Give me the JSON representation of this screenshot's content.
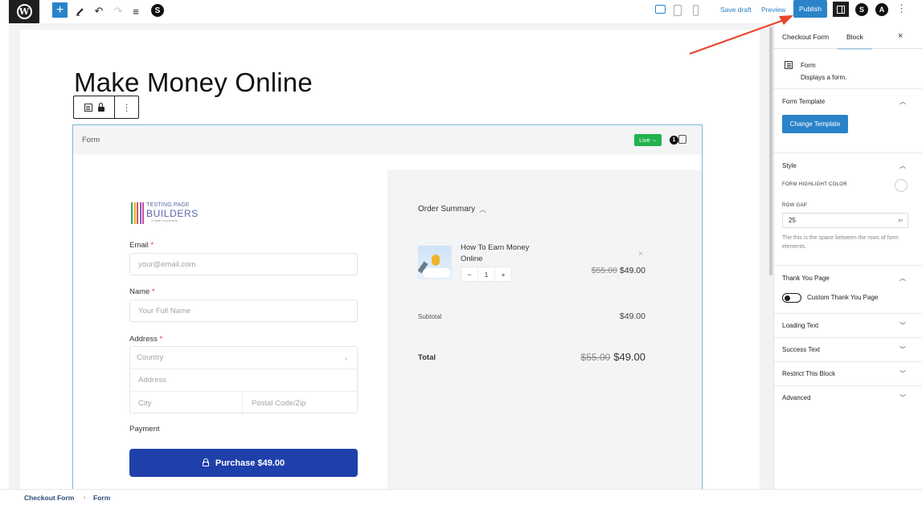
{
  "topbar": {
    "add_block_icon": "+",
    "tools_icon": "pencil-icon",
    "undo_icon": "↶",
    "redo_icon": "↷",
    "list_view_icon": "≡",
    "plugin_icon": "S",
    "save_draft": "Save draft",
    "preview": "Preview",
    "publish": "Publish",
    "plugin_s": "S",
    "plugin_a": "A",
    "more": "⋮"
  },
  "editor": {
    "page_title": "Make Money Online",
    "block_toolbar_more": "⋮",
    "form_block": {
      "label": "Form",
      "status": "Live",
      "status_color": "#22b24c",
      "cart_count": "1"
    },
    "checkout": {
      "logo": {
        "line1": "TESTING PAGE",
        "line2": "BUILDERS",
        "line3": "in depth comparisons",
        "bar_colors": [
          "#3aa655",
          "#e8b23b",
          "#d9534f",
          "#8e5bb5",
          "#d04fa3"
        ]
      },
      "email_label": "Email",
      "email_placeholder": "your@email.com",
      "name_label": "Name",
      "name_placeholder": "Your Full Name",
      "address_label": "Address",
      "country_placeholder": "Country",
      "address_placeholder": "Address",
      "city_placeholder": "City",
      "zip_placeholder": "Postal Code/Zip",
      "required_mark": "*",
      "payment_label": "Payment",
      "purchase_button": "Purchase $49.00"
    },
    "order_summary": {
      "title": "Order Summary",
      "item_name": "How To Earn Money Online",
      "quantity": "1",
      "qty_minus": "−",
      "qty_plus": "+",
      "remove": "×",
      "item_original_price": "$55.00",
      "item_price": "$49.00",
      "subtotal_label": "Subtotal",
      "subtotal_value": "$49.00",
      "total_label": "Total",
      "total_original": "$55.00",
      "total_value": "$49.00"
    }
  },
  "sidebar": {
    "tabs": [
      "Checkout Form",
      "Block"
    ],
    "active_tab": "Block",
    "close": "×",
    "block_name": "Form",
    "block_description": "Displays a form.",
    "panels": {
      "form_template": {
        "title": "Form Template",
        "button": "Change Template"
      },
      "style": {
        "title": "Style",
        "highlight_label": "FORM HIGHLIGHT COLOR",
        "row_gap_label": "ROW GAP",
        "row_gap_value": "25",
        "row_gap_unit": "px",
        "row_gap_help": "The this is the space between the rows of form elements."
      },
      "thank_you": {
        "title": "Thank You Page",
        "toggle_label": "Custom Thank You Page",
        "toggle_on": false
      },
      "collapsed": [
        "Loading Text",
        "Success Text",
        "Restrict This Block",
        "Advanced"
      ]
    }
  },
  "breadcrumb": [
    "Checkout Form",
    "Form"
  ],
  "annotation": {
    "arrow_color": "#e8452c"
  }
}
